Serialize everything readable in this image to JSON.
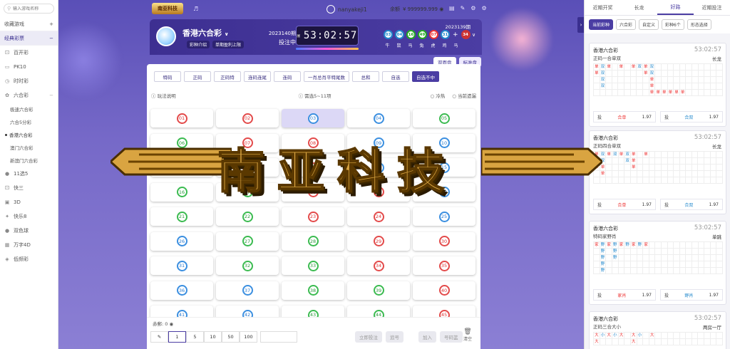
{
  "sidebar": {
    "search_placeholder": "输入游戏名称",
    "fav_label": "收藏游戏",
    "classic_label": "经典彩票",
    "items": [
      {
        "label": "百开彩",
        "icon": "dice-icon"
      },
      {
        "label": "PK10",
        "icon": "car-icon"
      },
      {
        "label": "时时彩",
        "icon": "clock-icon"
      },
      {
        "label": "六合彩",
        "icon": "flower-icon"
      }
    ],
    "subitems": [
      "极速六合彩",
      "六合5分彩",
      "香港六合彩",
      "澳门六合彩",
      "新澳门六合彩"
    ],
    "items2": [
      {
        "label": "11选5",
        "icon": "ball-icon"
      },
      {
        "label": "快三",
        "icon": "dice-icon"
      },
      {
        "label": "3D",
        "icon": "cube-icon"
      },
      {
        "label": "快乐8",
        "icon": "star-icon"
      },
      {
        "label": "双色球",
        "icon": "ball-icon"
      },
      {
        "label": "万字4D",
        "icon": "grid-icon"
      },
      {
        "label": "低频彩",
        "icon": "tag-icon"
      }
    ]
  },
  "topbar": {
    "logo_text": "南亚科技",
    "username": "nanyakeji1",
    "balance_label": "余额",
    "balance": "¥ 999999.999"
  },
  "lottery": {
    "name": "香港六合彩",
    "link_intro": "彩种介绍",
    "link_max": "单期盈利上限",
    "issue": "2023140期",
    "status": "投注中",
    "countdown": "53:02:57",
    "prev_issue": "2023139期",
    "prev_balls": [
      {
        "n": "03",
        "c": "blue"
      },
      {
        "n": "04",
        "c": "blue"
      },
      {
        "n": "16",
        "c": "green"
      },
      {
        "n": "49",
        "c": "green"
      },
      {
        "n": "07",
        "c": "red"
      },
      {
        "n": "31",
        "c": "blue"
      }
    ],
    "special_ball": {
      "n": "34",
      "c": "red"
    },
    "zodiacs": [
      "牛",
      "鼠",
      "马",
      "兔",
      "虎",
      "鸡",
      "马"
    ]
  },
  "viewtabs": [
    "双面盘",
    "标准盘"
  ],
  "playtabs": [
    "特码",
    "正码",
    "正码特",
    "连码连尾",
    "连码",
    "一肖总肖平特尾数",
    "总和",
    "自选",
    "自选不中"
  ],
  "active_playtab": "自选不中",
  "info": {
    "rules": "玩法说明",
    "hint": "需选5~11项",
    "opt1": "冷热",
    "opt2": "当前遗漏"
  },
  "balls": [
    {
      "n": "01",
      "c": "red"
    },
    {
      "n": "02",
      "c": "red"
    },
    {
      "n": "03",
      "c": "blue"
    },
    {
      "n": "04",
      "c": "blue"
    },
    {
      "n": "05",
      "c": "green"
    },
    {
      "n": "06",
      "c": "green"
    },
    {
      "n": "07",
      "c": "red"
    },
    {
      "n": "08",
      "c": "red"
    },
    {
      "n": "09",
      "c": "blue"
    },
    {
      "n": "10",
      "c": "blue"
    },
    {
      "n": "11",
      "c": "green"
    },
    {
      "n": "12",
      "c": "red"
    },
    {
      "n": "13",
      "c": "red"
    },
    {
      "n": "14",
      "c": "blue"
    },
    {
      "n": "15",
      "c": "blue"
    },
    {
      "n": "16",
      "c": "green"
    },
    {
      "n": "17",
      "c": "green"
    },
    {
      "n": "18",
      "c": "red"
    },
    {
      "n": "19",
      "c": "red"
    },
    {
      "n": "20",
      "c": "blue"
    },
    {
      "n": "21",
      "c": "green"
    },
    {
      "n": "22",
      "c": "green"
    },
    {
      "n": "23",
      "c": "red"
    },
    {
      "n": "24",
      "c": "red"
    },
    {
      "n": "25",
      "c": "blue"
    },
    {
      "n": "26",
      "c": "blue"
    },
    {
      "n": "27",
      "c": "green"
    },
    {
      "n": "28",
      "c": "green"
    },
    {
      "n": "29",
      "c": "red"
    },
    {
      "n": "30",
      "c": "red"
    },
    {
      "n": "31",
      "c": "blue"
    },
    {
      "n": "32",
      "c": "green"
    },
    {
      "n": "33",
      "c": "green"
    },
    {
      "n": "34",
      "c": "red"
    },
    {
      "n": "35",
      "c": "red"
    },
    {
      "n": "36",
      "c": "blue"
    },
    {
      "n": "37",
      "c": "blue"
    },
    {
      "n": "38",
      "c": "green"
    },
    {
      "n": "39",
      "c": "green"
    },
    {
      "n": "40",
      "c": "red"
    },
    {
      "n": "41",
      "c": "blue"
    },
    {
      "n": "42",
      "c": "blue"
    },
    {
      "n": "43",
      "c": "green"
    },
    {
      "n": "44",
      "c": "green"
    },
    {
      "n": "45",
      "c": "red"
    }
  ],
  "selected_balls": [
    "03"
  ],
  "bottom": {
    "line": "赤郵: 0",
    "multipliers": [
      "1",
      "5",
      "10",
      "50",
      "100"
    ],
    "btn_bet": "立即投注",
    "btn_fav": "追号",
    "btn_add": "加入",
    "btn_list": "号码篮",
    "clear": "清空"
  },
  "right": {
    "tabs": [
      "近期开奖",
      "长龙",
      "好路",
      "近期投注"
    ],
    "active_tab": "好路",
    "filters": [
      "当前彩种",
      "六合彩",
      "自定义",
      "彩种6个",
      "形态选择"
    ],
    "cards": [
      {
        "title": "香港六合彩",
        "time": "53:02:57",
        "sub": "正码一合单双",
        "streak": "长龙",
        "rows": [
          [
            "单",
            "双",
            "单",
            "",
            "单",
            "",
            "单",
            "双",
            "单",
            "双",
            "",
            "",
            "",
            "",
            "",
            "",
            "",
            "",
            "",
            "",
            ""
          ],
          [
            "单",
            "双",
            "",
            "",
            "",
            "",
            "",
            "",
            "单",
            "双",
            "",
            "",
            "",
            "",
            "",
            "",
            "",
            "",
            "",
            "",
            ""
          ],
          [
            "",
            "双",
            "",
            "",
            "",
            "",
            "",
            "",
            "",
            "单",
            "",
            "",
            "",
            "",
            "",
            "",
            "",
            "",
            "",
            "",
            ""
          ],
          [
            "",
            "双",
            "",
            "",
            "",
            "",
            "",
            "",
            "",
            "单",
            "",
            "",
            "",
            "",
            "",
            "",
            "",
            "",
            "",
            "",
            ""
          ],
          [
            "",
            "",
            "",
            "",
            "",
            "",
            "",
            "",
            "",
            "单",
            "单",
            "单",
            "单",
            "单",
            "单",
            "",
            "",
            "",
            "",
            "",
            ""
          ]
        ],
        "opt1": "合单",
        "odd1": "1.97",
        "opt2": "合双",
        "odd2": "1.97"
      },
      {
        "title": "香港六合彩",
        "time": "53:02:57",
        "sub": "正码四合单双",
        "streak": "长龙",
        "rows": [
          [
            "单",
            "双",
            "单",
            "双",
            "单",
            "双",
            "单",
            "",
            "单",
            "",
            "",
            "",
            "",
            "",
            "",
            "",
            "",
            "",
            "",
            "",
            ""
          ],
          [
            "单",
            "双",
            "",
            "",
            "",
            "双",
            "单",
            "",
            "",
            "",
            "",
            "",
            "",
            "",
            "",
            "",
            "",
            "",
            "",
            "",
            ""
          ],
          [
            "单",
            "单",
            "",
            "",
            "",
            "",
            "单",
            "",
            "",
            "",
            "",
            "",
            "",
            "",
            "",
            "",
            "",
            "",
            "",
            "",
            ""
          ],
          [
            "",
            "单",
            "",
            "",
            "",
            "",
            "",
            "",
            "",
            "",
            "",
            "",
            "",
            "",
            "",
            "",
            "",
            "",
            "",
            "",
            ""
          ],
          [
            "",
            "",
            "",
            "",
            "",
            "",
            "",
            "",
            "",
            "",
            "",
            "",
            "",
            "",
            "",
            "",
            "",
            "",
            "",
            "",
            ""
          ]
        ],
        "opt1": "合单",
        "odd1": "1.97",
        "opt2": "合双",
        "odd2": "1.97"
      },
      {
        "title": "香港六合彩",
        "time": "53:02:57",
        "sub": "特码家野肖",
        "streak": "单跳",
        "rows": [
          [
            "家",
            "野",
            "家",
            "野",
            "家",
            "野",
            "家",
            "野",
            "家",
            "",
            "",
            "",
            "",
            "",
            "",
            "",
            "",
            "",
            "",
            "",
            ""
          ],
          [
            "",
            "野",
            "",
            "野",
            "",
            "",
            "",
            "",
            "",
            "",
            "",
            "",
            "",
            "",
            "",
            "",
            "",
            "",
            "",
            "",
            ""
          ],
          [
            "",
            "野",
            "",
            "野",
            "",
            "",
            "",
            "",
            "",
            "",
            "",
            "",
            "",
            "",
            "",
            "",
            "",
            "",
            "",
            "",
            ""
          ],
          [
            "",
            "野",
            "",
            "",
            "",
            "",
            "",
            "",
            "",
            "",
            "",
            "",
            "",
            "",
            "",
            "",
            "",
            "",
            "",
            "",
            ""
          ],
          [
            "",
            "野",
            "",
            "",
            "",
            "",
            "",
            "",
            "",
            "",
            "",
            "",
            "",
            "",
            "",
            "",
            "",
            "",
            "",
            "",
            ""
          ]
        ],
        "opt1": "家肖",
        "odd1": "1.97",
        "opt2": "野肖",
        "odd2": "1.97"
      },
      {
        "title": "香港六合彩",
        "time": "53:02:57",
        "sub": "正码三合大小",
        "streak": "两房一厅",
        "rows": [
          [
            "大",
            "小",
            "大",
            "小",
            "大",
            "",
            "大",
            "小",
            "",
            "大",
            "",
            "",
            "",
            "",
            "",
            "",
            "",
            "",
            "",
            "",
            ""
          ],
          [
            "大",
            "",
            "",
            "",
            "",
            "",
            "大",
            "",
            "",
            "",
            "",
            "",
            "",
            "",
            "",
            "",
            "",
            "",
            "",
            "",
            ""
          ]
        ],
        "opt1": "大",
        "odd1": "1.97",
        "opt2": "小",
        "odd2": "1.97"
      }
    ]
  },
  "colors": {
    "accent": "#4b3da3",
    "red": "#e34a4a",
    "blue": "#3b8fe0",
    "green": "#3bbb50"
  }
}
